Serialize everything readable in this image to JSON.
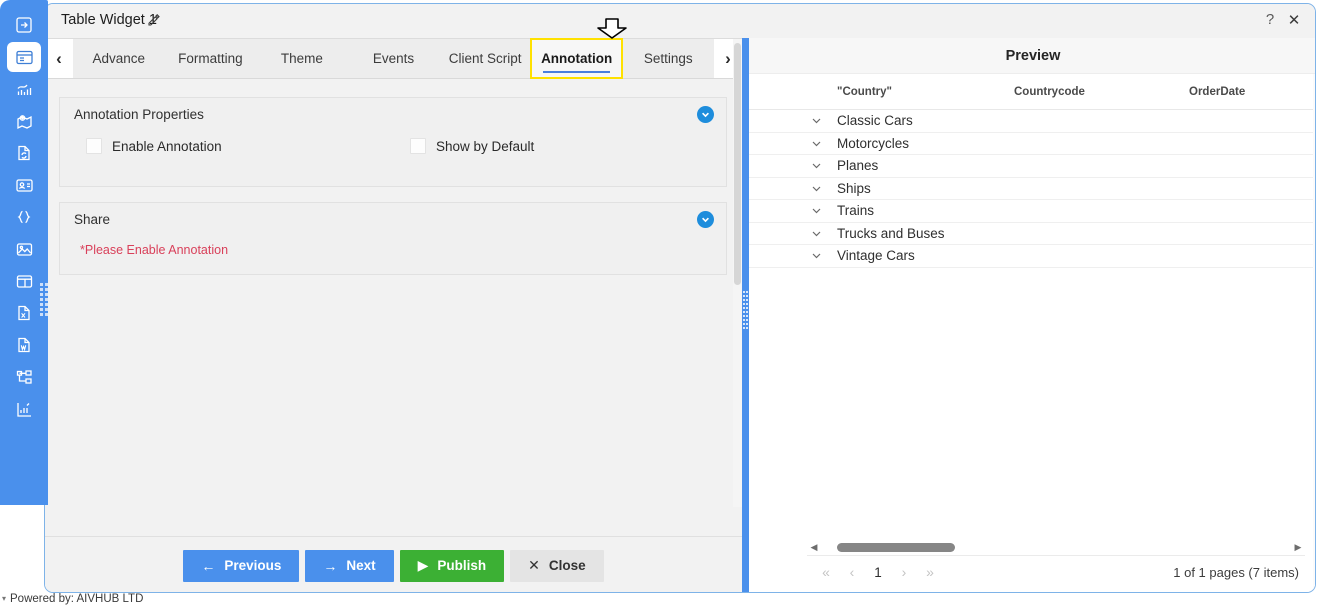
{
  "window": {
    "title": "Table Widget 1",
    "edit_icon": "pencil-edit-icon",
    "help_label": "?",
    "close_label": "✕"
  },
  "sidebar": {
    "items": [
      {
        "name": "export-icon",
        "active": false
      },
      {
        "name": "table-widget-icon",
        "active": true
      },
      {
        "name": "chart-icon",
        "active": false
      },
      {
        "name": "map-icon",
        "active": false
      },
      {
        "name": "document-sync-icon",
        "active": false
      },
      {
        "name": "contact-card-icon",
        "active": false
      },
      {
        "name": "code-braces-icon",
        "active": false
      },
      {
        "name": "image-icon",
        "active": false
      },
      {
        "name": "layout-panel-icon",
        "active": false
      },
      {
        "name": "excel-file-icon",
        "active": false
      },
      {
        "name": "word-file-icon",
        "active": false
      },
      {
        "name": "hierarchy-icon",
        "active": false
      },
      {
        "name": "report-icon",
        "active": false
      }
    ]
  },
  "tabs": {
    "prev_label": "‹",
    "next_label": "›",
    "items": [
      {
        "label": "Advance",
        "active": false
      },
      {
        "label": "Formatting",
        "active": false
      },
      {
        "label": "Theme",
        "active": false
      },
      {
        "label": "Events",
        "active": false
      },
      {
        "label": "Client Script",
        "active": false
      },
      {
        "label": "Annotation",
        "active": true
      },
      {
        "label": "Settings",
        "active": false
      }
    ]
  },
  "panels": {
    "annotation_properties": {
      "title": "Annotation Properties",
      "collapse_icon": "chevron-down-icon",
      "checkboxes": [
        {
          "label": "Enable Annotation",
          "checked": false
        },
        {
          "label": "Show by Default",
          "checked": false
        }
      ]
    },
    "share": {
      "title": "Share",
      "collapse_icon": "chevron-down-icon",
      "message": "*Please Enable Annotation"
    }
  },
  "footer_buttons": [
    {
      "label": "Previous",
      "icon": "←",
      "style": "blue"
    },
    {
      "label": "Next",
      "icon": "→",
      "style": "blue"
    },
    {
      "label": "Publish",
      "icon": "▶",
      "style": "green"
    },
    {
      "label": "Close",
      "icon": "✕",
      "style": "grey"
    }
  ],
  "preview": {
    "title": "Preview",
    "columns": [
      "\"Country\"",
      "Countrycode",
      "OrderDate"
    ],
    "rows": [
      {
        "expand_icon": "chevron-down-icon",
        "label": "Classic Cars"
      },
      {
        "expand_icon": "chevron-down-icon",
        "label": "Motorcycles"
      },
      {
        "expand_icon": "chevron-down-icon",
        "label": "Planes"
      },
      {
        "expand_icon": "chevron-down-icon",
        "label": "Ships"
      },
      {
        "expand_icon": "chevron-down-icon",
        "label": "Trains"
      },
      {
        "expand_icon": "chevron-down-icon",
        "label": "Trucks and Buses"
      },
      {
        "expand_icon": "chevron-down-icon",
        "label": "Vintage Cars"
      }
    ],
    "pager": {
      "first": "«",
      "prev": "‹",
      "current": "1",
      "next": "›",
      "last": "»",
      "info": "1 of 1 pages (7 items)"
    },
    "hscroll": {
      "left_arrow": "◀",
      "right_arrow": "▶"
    }
  },
  "status": {
    "powered_by": "Powered by: AIVHUB LTD"
  },
  "colors": {
    "accent_blue": "#4a90ec",
    "publish_green": "#3cb034",
    "error_red": "#d9405a",
    "highlight_yellow": "#ffe100"
  }
}
